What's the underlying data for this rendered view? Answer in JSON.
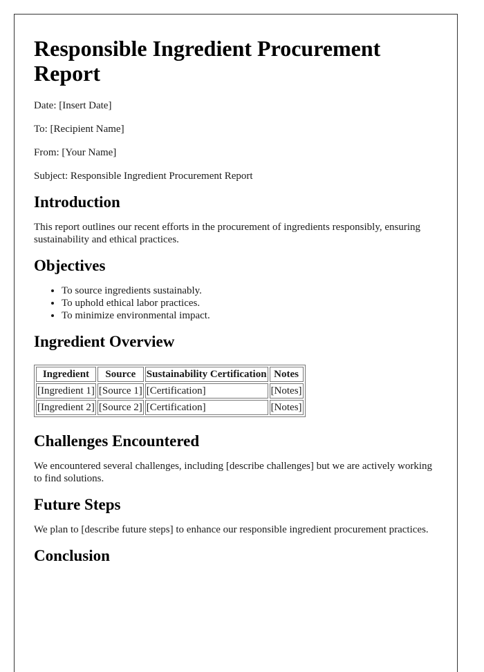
{
  "document": {
    "title": "Responsible Ingredient Procurement Report",
    "meta": {
      "date": "Date: [Insert Date]",
      "to": "To: [Recipient Name]",
      "from": "From: [Your Name]",
      "subject": "Subject: Responsible Ingredient Procurement Report"
    },
    "sections": {
      "introduction": {
        "heading": "Introduction",
        "body": "This report outlines our recent efforts in the procurement of ingredients responsibly, ensuring sustainability and ethical practices."
      },
      "objectives": {
        "heading": "Objectives",
        "items": [
          "To source ingredients sustainably.",
          "To uphold ethical labor practices.",
          "To minimize environmental impact."
        ]
      },
      "ingredient_overview": {
        "heading": "Ingredient Overview",
        "table": {
          "headers": [
            "Ingredient",
            "Source",
            "Sustainability Certification",
            "Notes"
          ],
          "rows": [
            [
              "[Ingredient 1]",
              "[Source 1]",
              "[Certification]",
              "[Notes]"
            ],
            [
              "[Ingredient 2]",
              "[Source 2]",
              "[Certification]",
              "[Notes]"
            ]
          ]
        }
      },
      "challenges": {
        "heading": "Challenges Encountered",
        "body": "We encountered several challenges, including [describe challenges] but we are actively working to find solutions."
      },
      "future_steps": {
        "heading": "Future Steps",
        "body": "We plan to [describe future steps] to enhance our responsible ingredient procurement practices."
      },
      "conclusion": {
        "heading": "Conclusion"
      }
    }
  }
}
